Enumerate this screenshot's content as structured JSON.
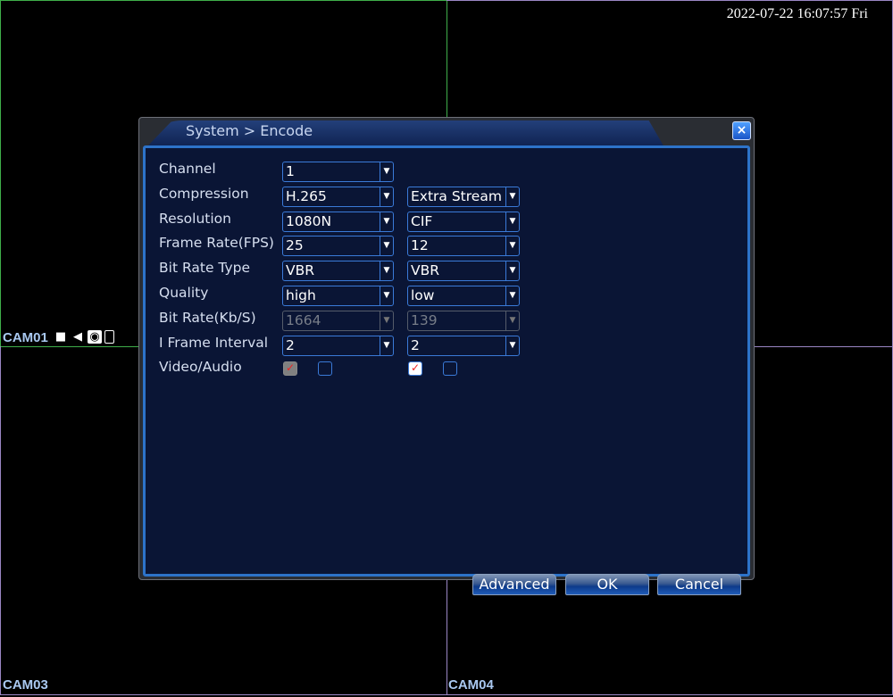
{
  "timestamp": "2022-07-22 16:07:57 Fri",
  "cameras": [
    "CAM01",
    "CAM03",
    "CAM04"
  ],
  "cam01_icons": [
    "camera-icon",
    "audio-muted-icon",
    "snapshot-icon",
    "mobile-icon"
  ],
  "dialog": {
    "title": "System > Encode",
    "close_label": "×",
    "labels": [
      "Channel",
      "Compression",
      "Resolution",
      "Frame Rate(FPS)",
      "Bit Rate Type",
      "Quality",
      "Bit Rate(Kb/S)",
      "I Frame Interval",
      "Video/Audio"
    ],
    "main": [
      "1",
      "H.265",
      "1080N",
      "25",
      "VBR",
      "high",
      "1664",
      "2"
    ],
    "extra": [
      "",
      "Extra Stream",
      "CIF",
      "12",
      "VBR",
      "low",
      "139",
      "2"
    ],
    "checks": {
      "main_video": true,
      "main_audio": false,
      "extra_video": true,
      "extra_audio": false
    },
    "buttons": {
      "advanced": "Advanced",
      "ok": "OK",
      "cancel": "Cancel"
    }
  },
  "colors": {
    "accent": "#2d73c9",
    "panel": "#0a1535",
    "check": "#e22222"
  }
}
